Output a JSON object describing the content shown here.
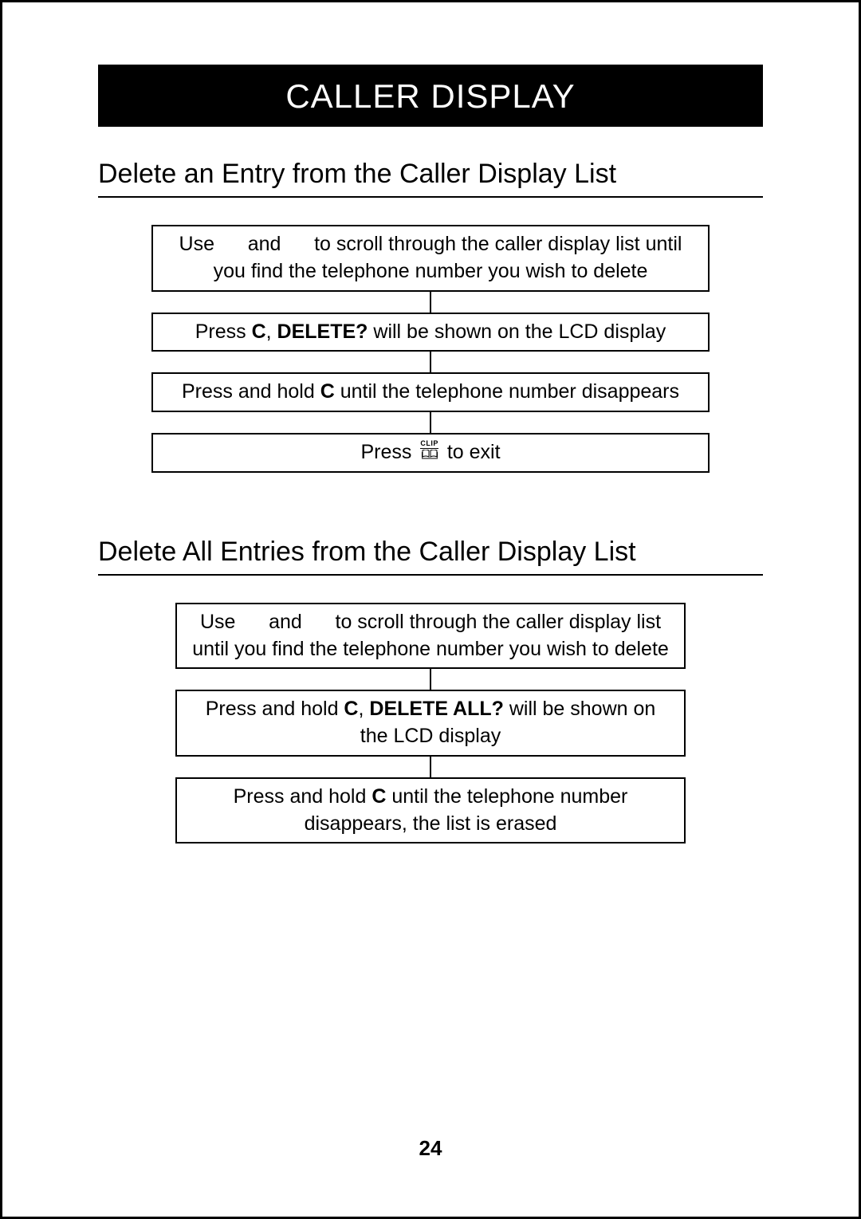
{
  "title": "CALLER DISPLAY",
  "section1": {
    "heading": "Delete an Entry from the Caller Display List",
    "step1_pre": "Use ",
    "step1_mid": " and ",
    "step1_post": " to scroll through the caller display list until you find the telephone number you wish to delete",
    "step2_pre": "Press ",
    "step2_c": "C",
    "step2_comma": ", ",
    "step2_delete": "DELETE?",
    "step2_post": " will be shown on the LCD display",
    "step3_pre": "Press and hold ",
    "step3_c": "C",
    "step3_post": " until the telephone number disappears",
    "step4_pre": "Press ",
    "step4_post": " to exit",
    "clip_label": "CLIP"
  },
  "section2": {
    "heading": "Delete All Entries from the Caller Display List",
    "step1_pre": "Use ",
    "step1_mid": " and ",
    "step1_post": " to scroll through the caller display list until you find the telephone number you wish to delete",
    "step2_pre": "Press and hold ",
    "step2_c": "C",
    "step2_comma": ", ",
    "step2_delete": "DELETE ALL?",
    "step2_post": " will be shown on the LCD display",
    "step3_pre": "Press and hold ",
    "step3_c": "C",
    "step3_post": " until the telephone number disappears, the list is erased"
  },
  "page_number": "24"
}
